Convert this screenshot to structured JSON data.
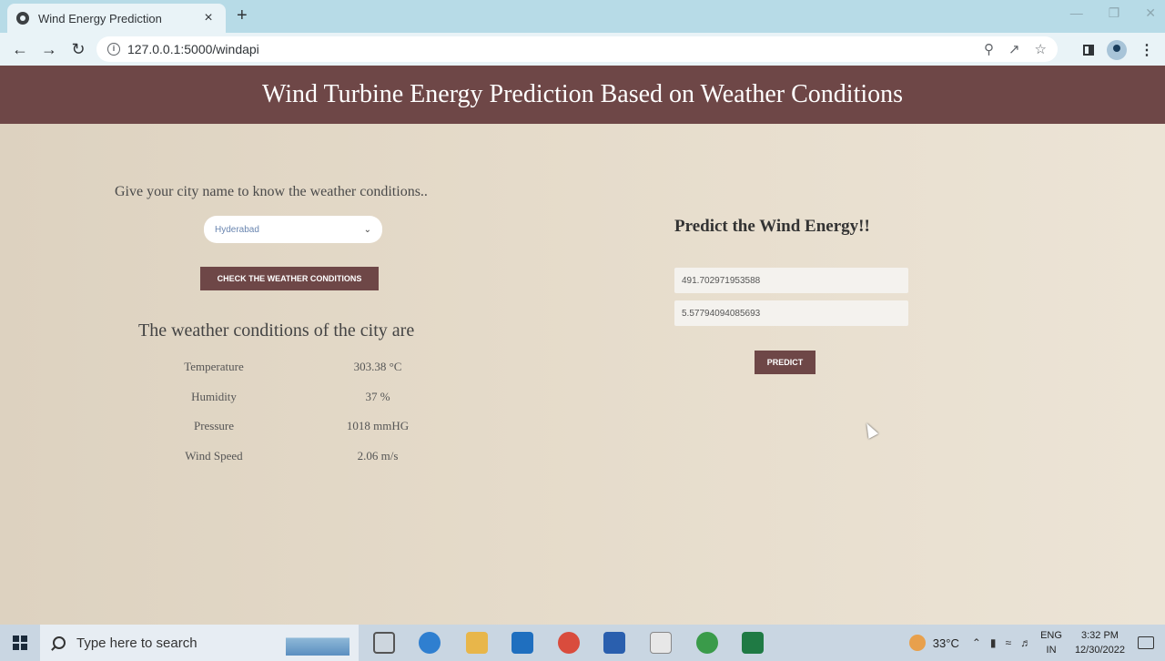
{
  "browser": {
    "tab_title": "Wind Energy Prediction",
    "tab_close": "×",
    "new_tab": "+",
    "url": "127.0.0.1:5000/windapi"
  },
  "page": {
    "header_title": "Wind Turbine Energy Prediction Based on Weather Conditions",
    "city_prompt": "Give your city name to know the weather conditions..",
    "city_selected": "Hyderabad",
    "check_button": "CHECK THE WEATHER CONDITIONS",
    "weather_title": "The weather conditions of the city are",
    "weather": [
      {
        "label": "Temperature",
        "value": "303.38 °C"
      },
      {
        "label": "Humidity",
        "value": "37 %"
      },
      {
        "label": "Pressure",
        "value": "1018 mmHG"
      },
      {
        "label": "Wind Speed",
        "value": "2.06 m/s"
      }
    ],
    "predict_title": "Predict the Wind Energy!!",
    "input_1": "491.702971953588",
    "input_2": "5.57794094085693",
    "predict_button": "PREDICT"
  },
  "taskbar": {
    "search_placeholder": "Type here to search",
    "temperature": "33°C",
    "lang_1": "ENG",
    "lang_2": "IN",
    "time": "3:32 PM",
    "date": "12/30/2022"
  },
  "colors": {
    "accent": "#6e4747",
    "page_bg": "#e6dccb",
    "taskbar_bg": "#c9d6e2"
  }
}
